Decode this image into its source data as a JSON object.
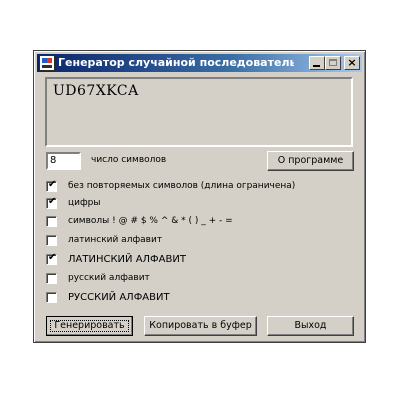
{
  "window": {
    "title": "Генератор случайной последовательности",
    "controls": {
      "minimize": "_",
      "maximize": "□",
      "close": "×"
    }
  },
  "output": {
    "value": "UD67XKCA"
  },
  "count": {
    "value": "8",
    "label": "число символов"
  },
  "buttons": {
    "about": "О программе",
    "generate": "Генерировать",
    "copy": "Копировать в буфер",
    "exit": "Выход"
  },
  "options": [
    {
      "label": "без повторяемых символов (длина ограничена)",
      "checked": true
    },
    {
      "label": "цифры",
      "checked": true
    },
    {
      "label": "символы ! @ # $ % ^ & * ( ) _ + - =",
      "checked": false
    },
    {
      "label": "латинский алфавит",
      "checked": false
    },
    {
      "label": "ЛАТИНСКИЙ АЛФАВИТ",
      "checked": true
    },
    {
      "label": "русский алфавит",
      "checked": false
    },
    {
      "label": "РУССКИЙ АЛФАВИТ",
      "checked": false
    }
  ],
  "icons": {
    "app": "app-icon",
    "check": "✔"
  }
}
